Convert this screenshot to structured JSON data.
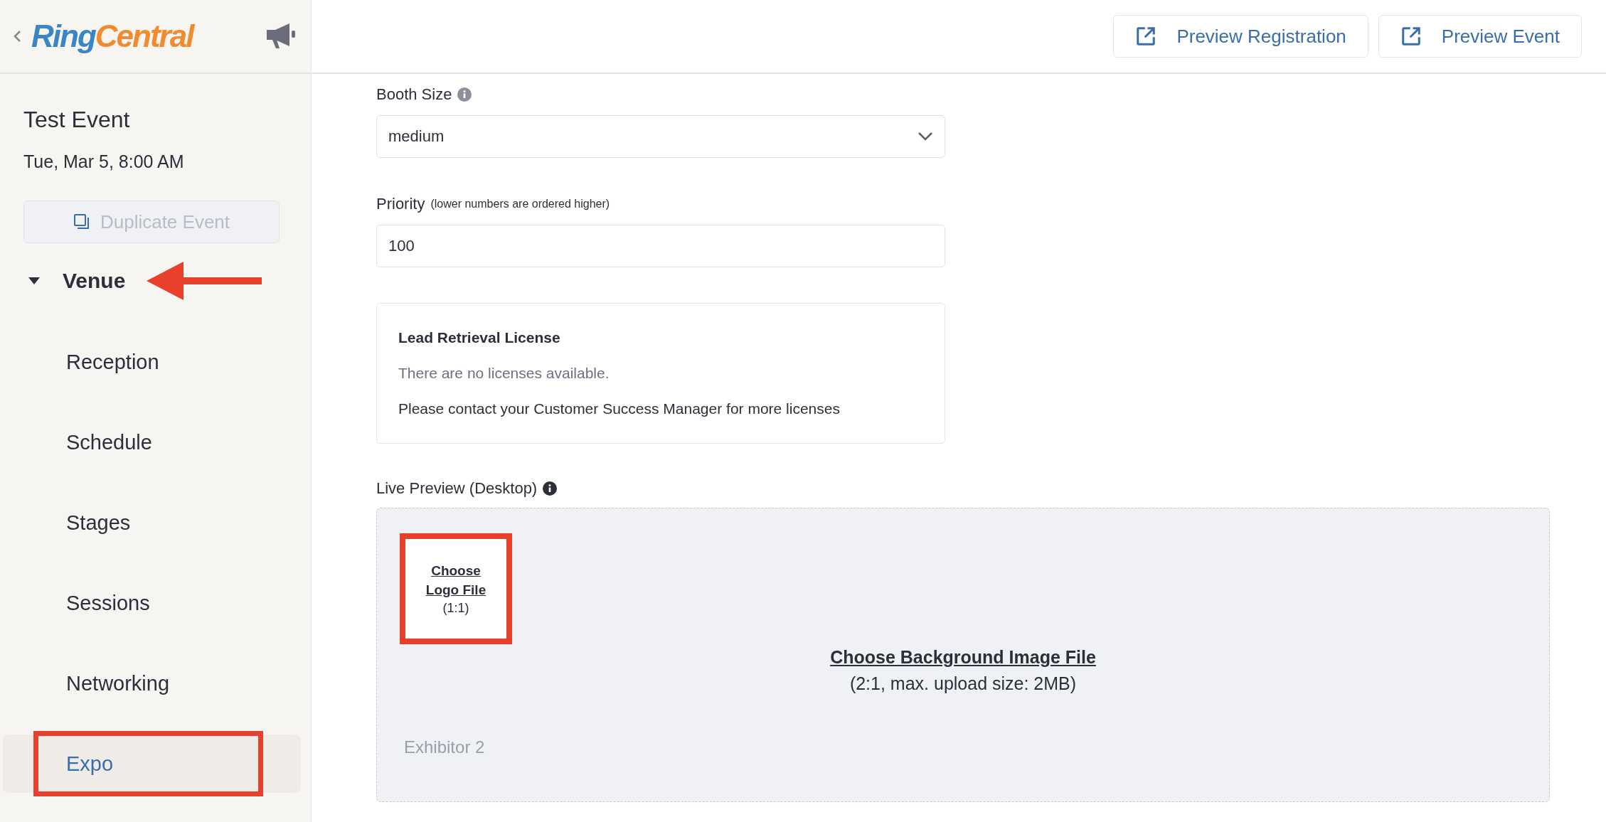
{
  "logo": {
    "first": "Ring",
    "second": "Central"
  },
  "header_buttons": [
    "Preview Registration",
    "Preview Event"
  ],
  "event": {
    "title": "Test Event",
    "date": "Tue, Mar 5, 8:00 AM",
    "duplicate_button": {
      "label": "Duplicate Event",
      "disabled": true
    }
  },
  "nav": {
    "section": {
      "label": "Venue",
      "expanded": true,
      "arrow": true
    },
    "items": [
      {
        "label": "Reception",
        "selected": false,
        "highlighted": false
      },
      {
        "label": "Schedule",
        "selected": false,
        "highlighted": false
      },
      {
        "label": "Stages",
        "selected": false,
        "highlighted": false
      },
      {
        "label": "Sessions",
        "selected": false,
        "highlighted": false
      },
      {
        "label": "Networking",
        "selected": false,
        "highlighted": false
      },
      {
        "label": "Expo",
        "selected": true,
        "highlighted": true
      }
    ]
  },
  "booth_size": {
    "label": "Booth Size",
    "value": "medium"
  },
  "priority": {
    "label": "Priority",
    "hint": "(lower numbers are ordered higher)",
    "value": "100"
  },
  "license": {
    "title": "Lead Retrieval License",
    "status": "There are no licenses available.",
    "note": "Please contact your Customer Success Manager for more licenses"
  },
  "live_preview": {
    "label": "Live Preview (Desktop)",
    "logo_link": "Choose Logo File",
    "logo_ratio": "(1:1)",
    "logo_highlighted": true,
    "background_link": "Choose Background Image File",
    "background_hint": "(2:1, max. upload size: 2MB)",
    "exhibitor": "Exhibitor 2"
  }
}
